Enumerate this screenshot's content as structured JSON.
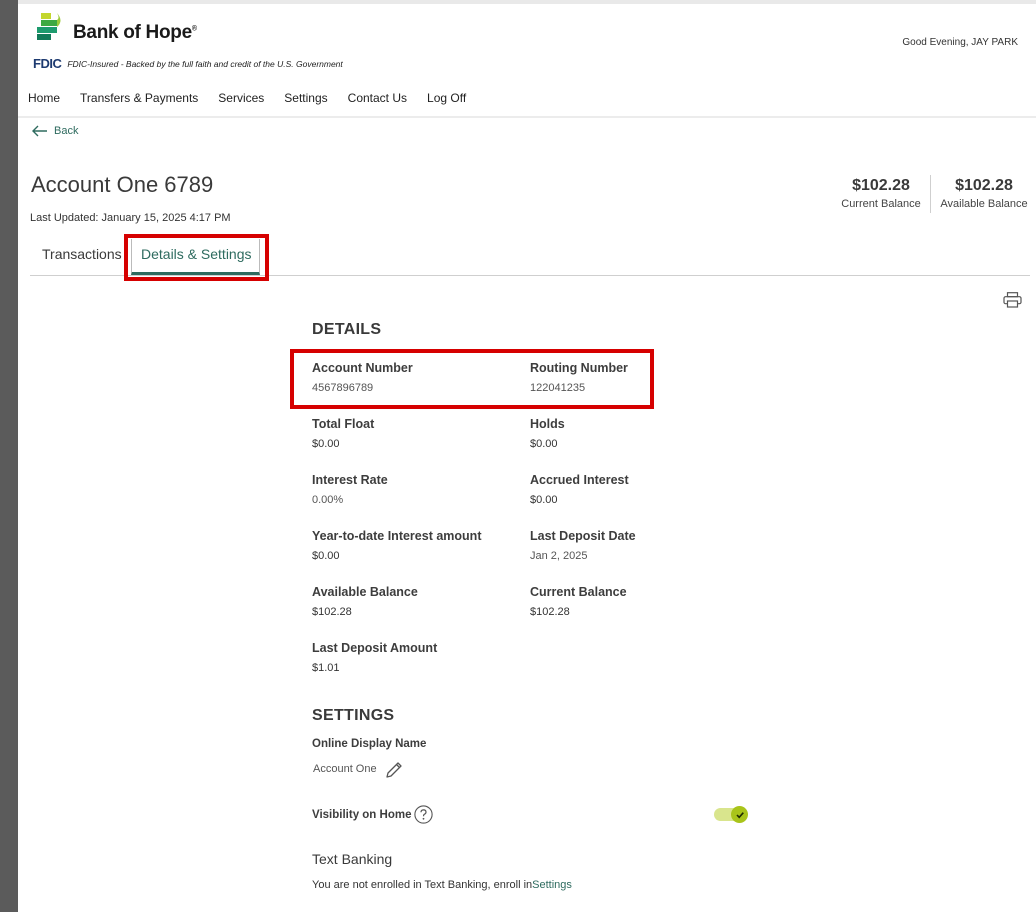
{
  "header": {
    "brand": "Bank of Hope",
    "brand_mark": "®",
    "fdic_badge": "FDIC",
    "fdic_text": "FDIC-Insured - Backed by the full faith and credit of the U.S. Government",
    "greeting": "Good Evening, JAY PARK"
  },
  "nav": {
    "items": [
      "Home",
      "Transfers & Payments",
      "Services",
      "Settings",
      "Contact Us",
      "Log Off"
    ]
  },
  "back_label": "Back",
  "account": {
    "title": "Account One 6789",
    "last_updated": "Last Updated: January 15, 2025 4:17 PM",
    "current_balance": "$102.28",
    "current_balance_label": "Current Balance",
    "available_balance": "$102.28",
    "available_balance_label": "Available Balance"
  },
  "tabs": [
    {
      "label": "Transactions",
      "active": false
    },
    {
      "label": "Details & Settings",
      "active": true
    }
  ],
  "details": {
    "heading": "DETAILS",
    "fields": [
      {
        "label": "Account Number",
        "value": "4567896789"
      },
      {
        "label": "Routing Number",
        "value": "122041235"
      },
      {
        "label": "Total Float",
        "value": "$0.00"
      },
      {
        "label": "Holds",
        "value": "$0.00"
      },
      {
        "label": "Interest Rate",
        "value": "0.00%"
      },
      {
        "label": "Accrued Interest",
        "value": "$0.00"
      },
      {
        "label": "Year-to-date Interest amount",
        "value": "$0.00"
      },
      {
        "label": "Last Deposit Date",
        "value": "Jan 2, 2025"
      },
      {
        "label": "Available Balance",
        "value": "$102.28"
      },
      {
        "label": "Current Balance",
        "value": "$102.28"
      },
      {
        "label": "Last Deposit Amount",
        "value": "$1.01"
      }
    ]
  },
  "settings": {
    "heading": "SETTINGS",
    "online_display_name_label": "Online Display Name",
    "online_display_name_value": "Account One",
    "visibility_label": "Visibility on Home",
    "visibility_on": true,
    "text_banking_heading": "Text Banking",
    "text_banking_msg": "You are not enrolled in Text Banking, enroll in",
    "text_banking_link": "Settings"
  },
  "colors": {
    "accent": "#2e6b5f",
    "highlight_box": "#d60000",
    "toggle_on": "#a9c41a"
  }
}
